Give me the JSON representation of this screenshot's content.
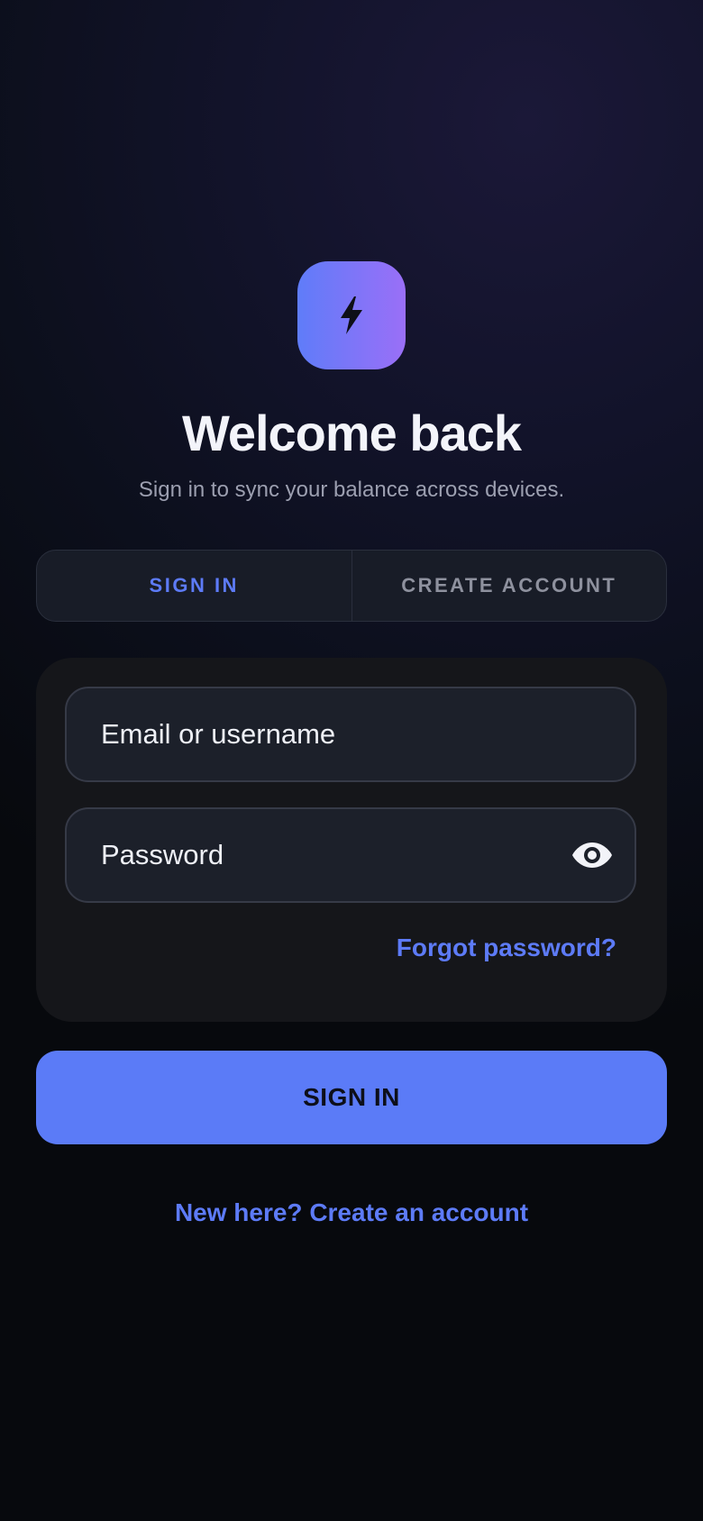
{
  "brand": {
    "logo_icon": "lightning-bolt-icon",
    "logo_gradient": [
      "#5f7cf9",
      "#9a6ff7"
    ]
  },
  "header": {
    "title": "Welcome back",
    "subtitle": "Sign in to sync your balance across devices."
  },
  "tabs": [
    {
      "label": "SIGN IN",
      "active": true
    },
    {
      "label": "CREATE ACCOUNT",
      "active": false
    }
  ],
  "form": {
    "email": {
      "placeholder": "Email or username",
      "value": ""
    },
    "password": {
      "placeholder": "Password",
      "value": "",
      "toggle_icon": "eye-icon"
    },
    "forgot_label": "Forgot password?"
  },
  "actions": {
    "submit_label": "SIGN IN",
    "create_account_label": "New here? Create an account"
  },
  "colors": {
    "accent": "#5b7bf7",
    "card_bg": "#15161a",
    "field_bg": "#1c202a"
  }
}
